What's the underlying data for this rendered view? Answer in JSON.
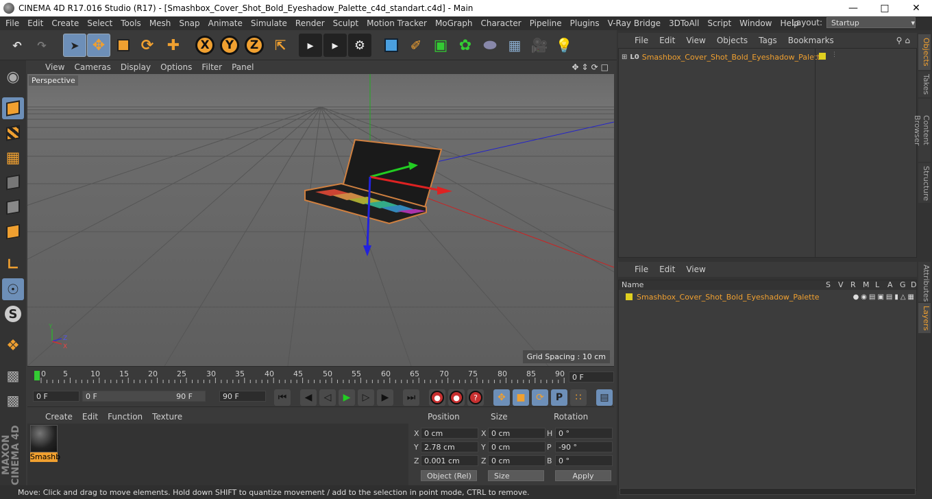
{
  "window": {
    "title": "CINEMA 4D R17.016 Studio (R17) - [Smashbox_Cover_Shot_Bold_Eyeshadow_Palette_c4d_standart.c4d] - Main"
  },
  "menu": [
    "File",
    "Edit",
    "Create",
    "Select",
    "Tools",
    "Mesh",
    "Snap",
    "Animate",
    "Simulate",
    "Render",
    "Sculpt",
    "Motion Tracker",
    "MoGraph",
    "Character",
    "Pipeline",
    "Plugins",
    "V-Ray Bridge",
    "3DToAll",
    "Script",
    "Window",
    "Help"
  ],
  "layout": {
    "label": "Layout:",
    "value": "Startup"
  },
  "toolbar": {
    "x": "X",
    "y": "Y",
    "z": "Z"
  },
  "viewport": {
    "menu": [
      "View",
      "Cameras",
      "Display",
      "Options",
      "Filter",
      "Panel"
    ],
    "label": "Perspective",
    "grid_spacing": "Grid Spacing : 10 cm"
  },
  "timeline": {
    "ticks": [
      "0",
      "5",
      "10",
      "15",
      "20",
      "25",
      "30",
      "35",
      "40",
      "45",
      "50",
      "55",
      "60",
      "65",
      "70",
      "75",
      "80",
      "85",
      "90"
    ],
    "end_field": "0 F",
    "start": "0 F",
    "range_start": "0 F",
    "range_end": "90 F",
    "end": "90 F"
  },
  "material": {
    "menu": [
      "Create",
      "Edit",
      "Function",
      "Texture"
    ],
    "name": "Smashb"
  },
  "coords": {
    "headers": [
      "Position",
      "Size",
      "Rotation"
    ],
    "rows": [
      {
        "axis": "X",
        "pos": "0 cm",
        "saxis": "X",
        "size": "0 cm",
        "raxis": "H",
        "rot": "0 °"
      },
      {
        "axis": "Y",
        "pos": "2.78 cm",
        "saxis": "Y",
        "size": "0 cm",
        "raxis": "P",
        "rot": "-90 °"
      },
      {
        "axis": "Z",
        "pos": "0.001 cm",
        "saxis": "Z",
        "size": "0 cm",
        "raxis": "B",
        "rot": "0 °"
      }
    ],
    "mode": "Object (Rel)",
    "size_mode": "Size",
    "apply": "Apply"
  },
  "status": "Move: Click and drag to move elements. Hold down SHIFT to quantize movement / add to the selection in point mode, CTRL to remove.",
  "objects": {
    "menu": [
      "File",
      "Edit",
      "View",
      "Objects",
      "Tags",
      "Bookmarks"
    ],
    "item": "Smashbox_Cover_Shot_Bold_Eyeshadow_Palette"
  },
  "layers": {
    "menu": [
      "File",
      "Edit",
      "View"
    ],
    "name_header": "Name",
    "cols": [
      "S",
      "V",
      "R",
      "M",
      "L",
      "A",
      "G",
      "D"
    ],
    "item": "Smashbox_Cover_Shot_Bold_Eyeshadow_Palette"
  },
  "side_tabs": {
    "objects": "Objects",
    "takes": "Takes",
    "content": "Content Browser",
    "structure": "Structure",
    "attributes": "Attributes",
    "layers": "Layers"
  },
  "colors": {
    "accent": "#f0a030",
    "selected": "#6d8fb8"
  }
}
